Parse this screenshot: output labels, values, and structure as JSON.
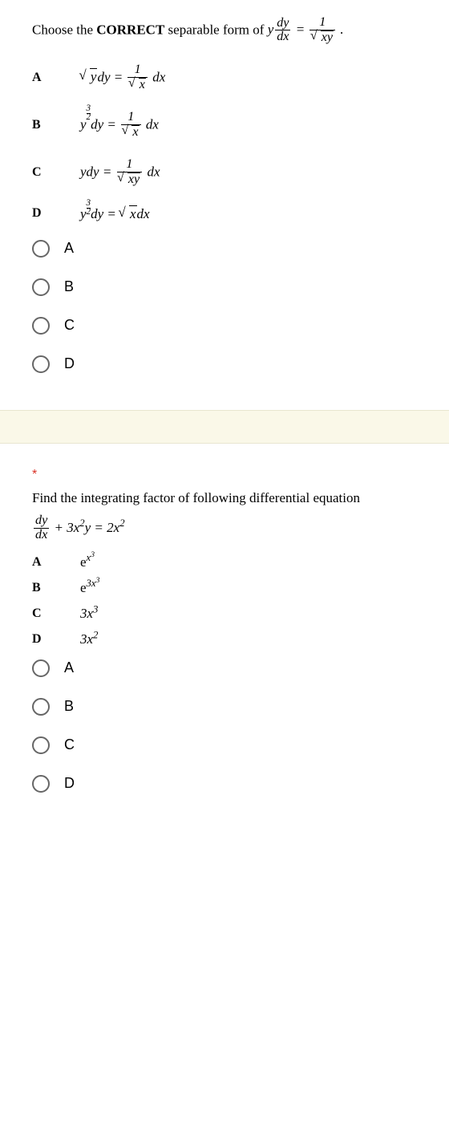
{
  "q1": {
    "stem_prefix": "Choose the ",
    "stem_bold": "CORRECT",
    "stem_suffix": " separable form of ",
    "labels": {
      "A": "A",
      "B": "B",
      "C": "C",
      "D": "D"
    },
    "options": {
      "A": "A",
      "B": "B",
      "C": "C",
      "D": "D"
    }
  },
  "q2": {
    "required_marker": "*",
    "stem": "Find the integrating factor of following differential equation",
    "labels": {
      "A": "A",
      "B": "B",
      "C": "C",
      "D": "D"
    },
    "options": {
      "A": "A",
      "B": "B",
      "C": "C",
      "D": "D"
    }
  },
  "chart_data": {
    "type": "table",
    "questions": [
      {
        "id": 1,
        "prompt": "Choose the CORRECT separable form of y · dy/dx = 1 / √(xy).",
        "items": {
          "A": "√y dy = (1/√x) dx",
          "B": "y^(3/2) dy = (1/√x) dx",
          "C": "y dy = (1/√(xy)) dx",
          "D": "y^(3/2) dy = √x dx"
        },
        "choices": [
          "A",
          "B",
          "C",
          "D"
        ]
      },
      {
        "id": 2,
        "prompt": "Find the integrating factor of following differential equation dy/dx + 3x^2 y = 2x^2",
        "items": {
          "A": "e^(x^3)",
          "B": "e^(3x^3)",
          "C": "3x^3",
          "D": "3x^2"
        },
        "choices": [
          "A",
          "B",
          "C",
          "D"
        ]
      }
    ]
  }
}
